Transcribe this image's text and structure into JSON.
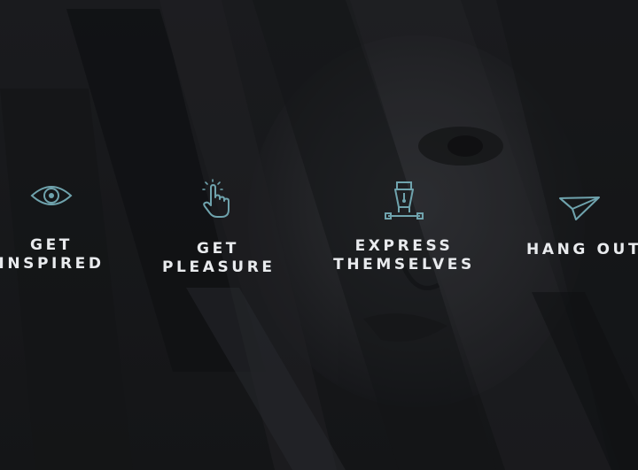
{
  "features": [
    {
      "icon": "eye-icon",
      "line1": "GET",
      "line2": "INSPIRED"
    },
    {
      "icon": "pointing-hand-icon",
      "line1": "GET",
      "line2": "PLEASURE"
    },
    {
      "icon": "pen-nib-icon",
      "line1": "EXPRESS",
      "line2": "THEMSELVES"
    },
    {
      "icon": "paper-plane-icon",
      "line1": "HANG OUT"
    }
  ],
  "colors": {
    "icon_accent": "#6fa3ad",
    "label_text": "#e9ebee",
    "background": "#17181b"
  }
}
